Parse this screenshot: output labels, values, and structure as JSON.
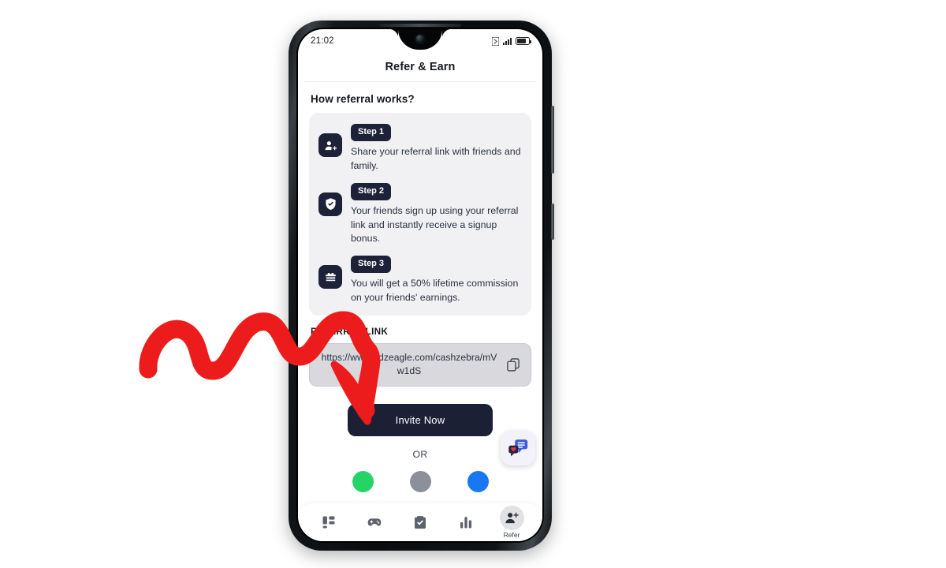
{
  "status_bar": {
    "time": "21:02",
    "icons": [
      "nfc-icon",
      "signal-icon",
      "battery-icon"
    ]
  },
  "app": {
    "header_title": "Refer & Earn",
    "section_title": "How referral works?",
    "steps": [
      {
        "badge": "Step 1",
        "text": "Share your referral link with friends and family.",
        "icon": "person-add-icon"
      },
      {
        "badge": "Step 2",
        "text": "Your friends sign up using your referral link and instantly receive a signup bonus.",
        "icon": "shield-check-icon"
      },
      {
        "badge": "Step 3",
        "text": "You will get a 50% lifetime commission on your friends' earnings.",
        "icon": "gift-icon"
      }
    ],
    "referral": {
      "label": "REFERRAL LINK",
      "url": "https://www.adzeagle.com/cashzebra/mVw1dS",
      "copy_icon": "copy-icon"
    },
    "invite_button": "Invite Now",
    "or_divider": "OR",
    "share_targets": [
      {
        "name": "whatsapp-share-icon",
        "color": "#25d366"
      },
      {
        "name": "telegram-share-icon",
        "color": "#8b9099"
      },
      {
        "name": "facebook-share-icon",
        "color": "#1877f2"
      }
    ],
    "chat_widget": {
      "icon": "chat-bubbles-icon"
    },
    "bottom_nav": [
      {
        "label": "",
        "icon": "dashboard-grid-icon",
        "active": false
      },
      {
        "label": "",
        "icon": "gamepad-icon",
        "active": false
      },
      {
        "label": "",
        "icon": "clipboard-check-icon",
        "active": false
      },
      {
        "label": "",
        "icon": "bar-chart-icon",
        "active": false
      },
      {
        "label": "Refer",
        "icon": "person-add-icon",
        "active": true
      }
    ]
  },
  "annotation": {
    "type": "arrow",
    "color": "#ed1c1c",
    "description": "red squiggly arrow pointing to Invite Now button"
  },
  "theme": {
    "dark_navy": "#1d2238",
    "card_bg": "#f1f1f3",
    "link_bg": "#d9d9dd",
    "accent_red": "#ed1c1c"
  }
}
